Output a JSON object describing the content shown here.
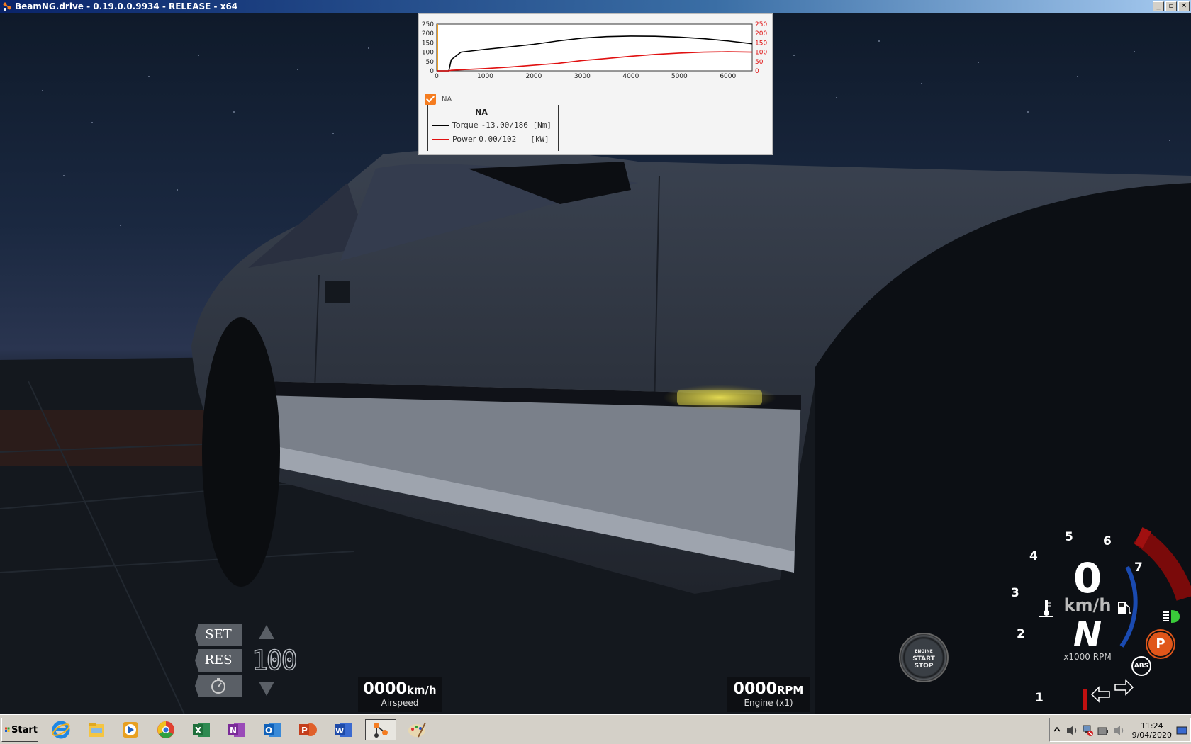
{
  "window": {
    "title": "BeamNG.drive - 0.19.0.0.9934 - RELEASE - x64",
    "controls": [
      "_",
      "▫",
      "✕"
    ]
  },
  "graph": {
    "left_axis_ticks": [
      "250",
      "200",
      "150",
      "100",
      "50",
      "0"
    ],
    "right_axis_ticks": [
      "250",
      "200",
      "150",
      "100",
      "50",
      "0"
    ],
    "x_ticks": [
      "0",
      "1000",
      "2000",
      "3000",
      "4000",
      "5000",
      "6000"
    ],
    "toggle_label": "NA",
    "legend_title": "NA",
    "torque": {
      "label": "Torque",
      "value": "-13.00/186 [Nm]",
      "color": "#000000"
    },
    "power": {
      "label": "Power",
      "value": "0.00/102   [kW]",
      "color": "#e01010"
    }
  },
  "chart_data": {
    "type": "line",
    "x": [
      0,
      250,
      300,
      500,
      1000,
      1500,
      2000,
      2500,
      3000,
      3500,
      4000,
      4500,
      5000,
      5500,
      6000,
      6500
    ],
    "series": [
      {
        "name": "Torque",
        "values": [
          -13,
          -13,
          60,
          100,
          115,
          128,
          142,
          160,
          175,
          183,
          186,
          185,
          180,
          172,
          160,
          145
        ]
      },
      {
        "name": "Power",
        "values": [
          0,
          0,
          3,
          6,
          12,
          20,
          30,
          40,
          55,
          66,
          78,
          88,
          95,
          100,
          102,
          100
        ]
      }
    ],
    "xlim": [
      0,
      6500
    ],
    "ylim": [
      0,
      250
    ],
    "y2lim": [
      0,
      250
    ],
    "grid": false,
    "colors": {
      "Torque": "#000000",
      "Power": "#e01010"
    }
  },
  "cruise": {
    "set_label": "SET",
    "res_label": "RES",
    "speed": "100"
  },
  "airspeed": {
    "value": "0000",
    "unit": "km/h",
    "caption": "Airspeed"
  },
  "engine": {
    "value": "0000",
    "unit": "RPM",
    "caption": "Engine (x1)"
  },
  "start_button": {
    "top": "ENGINE",
    "line1": "START",
    "line2": "STOP"
  },
  "dash": {
    "rpm_numbers": [
      "1",
      "2",
      "3",
      "4",
      "5",
      "6",
      "7"
    ],
    "speed": "0",
    "speed_unit": "km/h",
    "gear": "N",
    "rpm_label": "x1000 RPM",
    "parking_letter": "P",
    "abs_label": "ABS"
  },
  "taskbar": {
    "start_label": "Start",
    "apps": [
      "internet-explorer-icon",
      "file-explorer-icon",
      "media-player-icon",
      "chrome-icon",
      "excel-icon",
      "onenote-icon",
      "outlook-icon",
      "powerpoint-icon",
      "word-icon",
      "beamng-icon",
      "paint-icon"
    ],
    "clock_time": "11:24",
    "clock_date": "9/04/2020"
  }
}
